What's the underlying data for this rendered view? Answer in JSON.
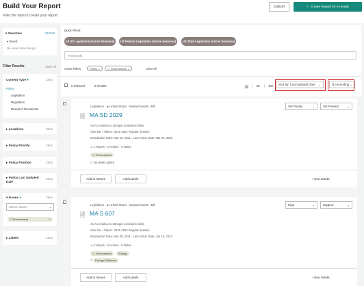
{
  "header": {
    "title": "Build Your Report",
    "subtitle": "Filter the data to create your report.",
    "cancel_label": "Cancel",
    "create_label": "Create Report for 6 results",
    "create_icon": "plus-icon"
  },
  "sidebar": {
    "searches": {
      "title": "Searches",
      "clear": "CLEAR",
      "saved_label": "Saved",
      "empty": "No saved searches yet"
    },
    "filter_results": {
      "title": "Filter Results",
      "clear_all": "Clear All"
    },
    "content_type": {
      "title": "Content Type",
      "clear": "Clear",
      "items": [
        "Policy",
        "Legislation",
        "Regulation",
        "Research Documents"
      ]
    },
    "sections": [
      {
        "title": "Locations",
        "clear": "Clear"
      },
      {
        "title": "Policy Priority",
        "clear": "Clear"
      },
      {
        "title": "Policy Position",
        "clear": "Clear"
      },
      {
        "title": "Policy Last Updated Date",
        "clear": "Clear"
      }
    ],
    "issues": {
      "title": "Issues",
      "clear": "Clear",
      "select_placeholder": "Select Issues",
      "selected": "Environment"
    },
    "labels": {
      "title": "Labels",
      "clear": "Clear"
    }
  },
  "main": {
    "quick_filters_label": "Quick Filters:",
    "quick_filters": [
      "All US Legislation (Active Sessions)",
      "US Federal Legislation (Active Sessions)",
      "US State Legislation (Active Sessions)"
    ],
    "keywords_placeholder": "Keywords",
    "active_filters_label": "Active Filters:",
    "active_filters": [
      "Policy",
      "Environment"
    ],
    "clear_all": "Clear All",
    "selected": "0 Selected",
    "results": "6 Results",
    "page_sizes": [
      "10",
      "50",
      "100"
    ],
    "sort_by": "Sort By: Last Updated Date",
    "order": "Ascending"
  },
  "bills": [
    {
      "breadcrumb": [
        "Legislation",
        "United States",
        "Massachusetts",
        "Bill"
      ],
      "title": "MA SD 2029",
      "description": "An Act relative to stronger emissions limits",
      "status": "Sine Die - Failed · 2021-2022 Regular Session",
      "intro": "Introduction Date: Mar 29, 2021",
      "last_action": "Last Action Date: Mar 29, 2021",
      "issues_count": "1 Issues",
      "actions_count": "0 Actions",
      "notes_count": "0 Notes",
      "tags": [
        "Environment"
      ],
      "labels": "No labels added",
      "priority": "Set Priority",
      "position": "Set Position",
      "add_issues": "Add to Issues",
      "add_labels": "Add Labels",
      "view": "View Details"
    },
    {
      "breadcrumb": [
        "Legislation",
        "United States",
        "Massachusetts",
        "Bill"
      ],
      "title": "MA S 607",
      "description": "An Act relative to stronger emissions limits",
      "status": "Sine Die - Failed · 2021-2022 Regular Session",
      "intro": "Introduction Date: Mar 29, 2021",
      "last_action": "Last Action Date: Jun 16, 2022",
      "issues_count": "2 Issues",
      "actions_count": "0 Actions",
      "notes_count": "0 Notes",
      "tags": [
        "Environment",
        "Energy"
      ],
      "labels": "Energy Efficiency",
      "priority": "High",
      "position": "Support",
      "add_issues": "Add to Issues",
      "add_labels": "Add Labels",
      "view": "View Details"
    }
  ]
}
